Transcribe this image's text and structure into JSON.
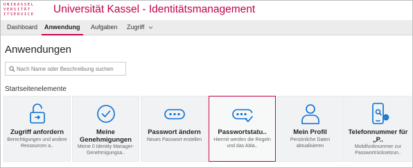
{
  "brand": {
    "logo_line1": "UNIKASSEL",
    "logo_line2": "VERSITÄT",
    "logo_line3": "ITSERVICE",
    "app_title": "Universität Kassel - Identitätsmanagement",
    "accent_color": "#c4004a"
  },
  "nav": {
    "tabs": [
      {
        "label": "Dashboard"
      },
      {
        "label": "Anwendung"
      },
      {
        "label": "Aufgaben"
      },
      {
        "label": "Zugriff"
      }
    ],
    "active_tab": "Anwendung"
  },
  "page": {
    "title": "Anwendungen",
    "search_placeholder": "Nach Name oder Beschreibung suchen",
    "section_title": "Startseitenelemente"
  },
  "tiles": [
    {
      "icon": "lock-unlocked-icon",
      "title": "Zugriff anfordern",
      "desc": "Berechtigungen und andere Ressourcen a.."
    },
    {
      "icon": "check-circle-icon",
      "title": "Meine Genehmigungen",
      "desc": "Meine 0 Identity Manager-Genehmigungsa.."
    },
    {
      "icon": "password-dots-icon",
      "title": "Passwort ändern",
      "desc": "Neues Passwort erstellen"
    },
    {
      "icon": "password-check-icon",
      "title": "Passwortstatu..",
      "desc": "Hiermit werden die Regeln und das Abla.."
    },
    {
      "icon": "person-icon",
      "title": "Mein Profil",
      "desc": "Persönliche Daten aktualisieren"
    },
    {
      "icon": "mobile-phone-icon",
      "title": "Telefonnummer für „P..",
      "desc": "Mobilfunknummer zur Passwortrücksetzun.."
    }
  ]
}
